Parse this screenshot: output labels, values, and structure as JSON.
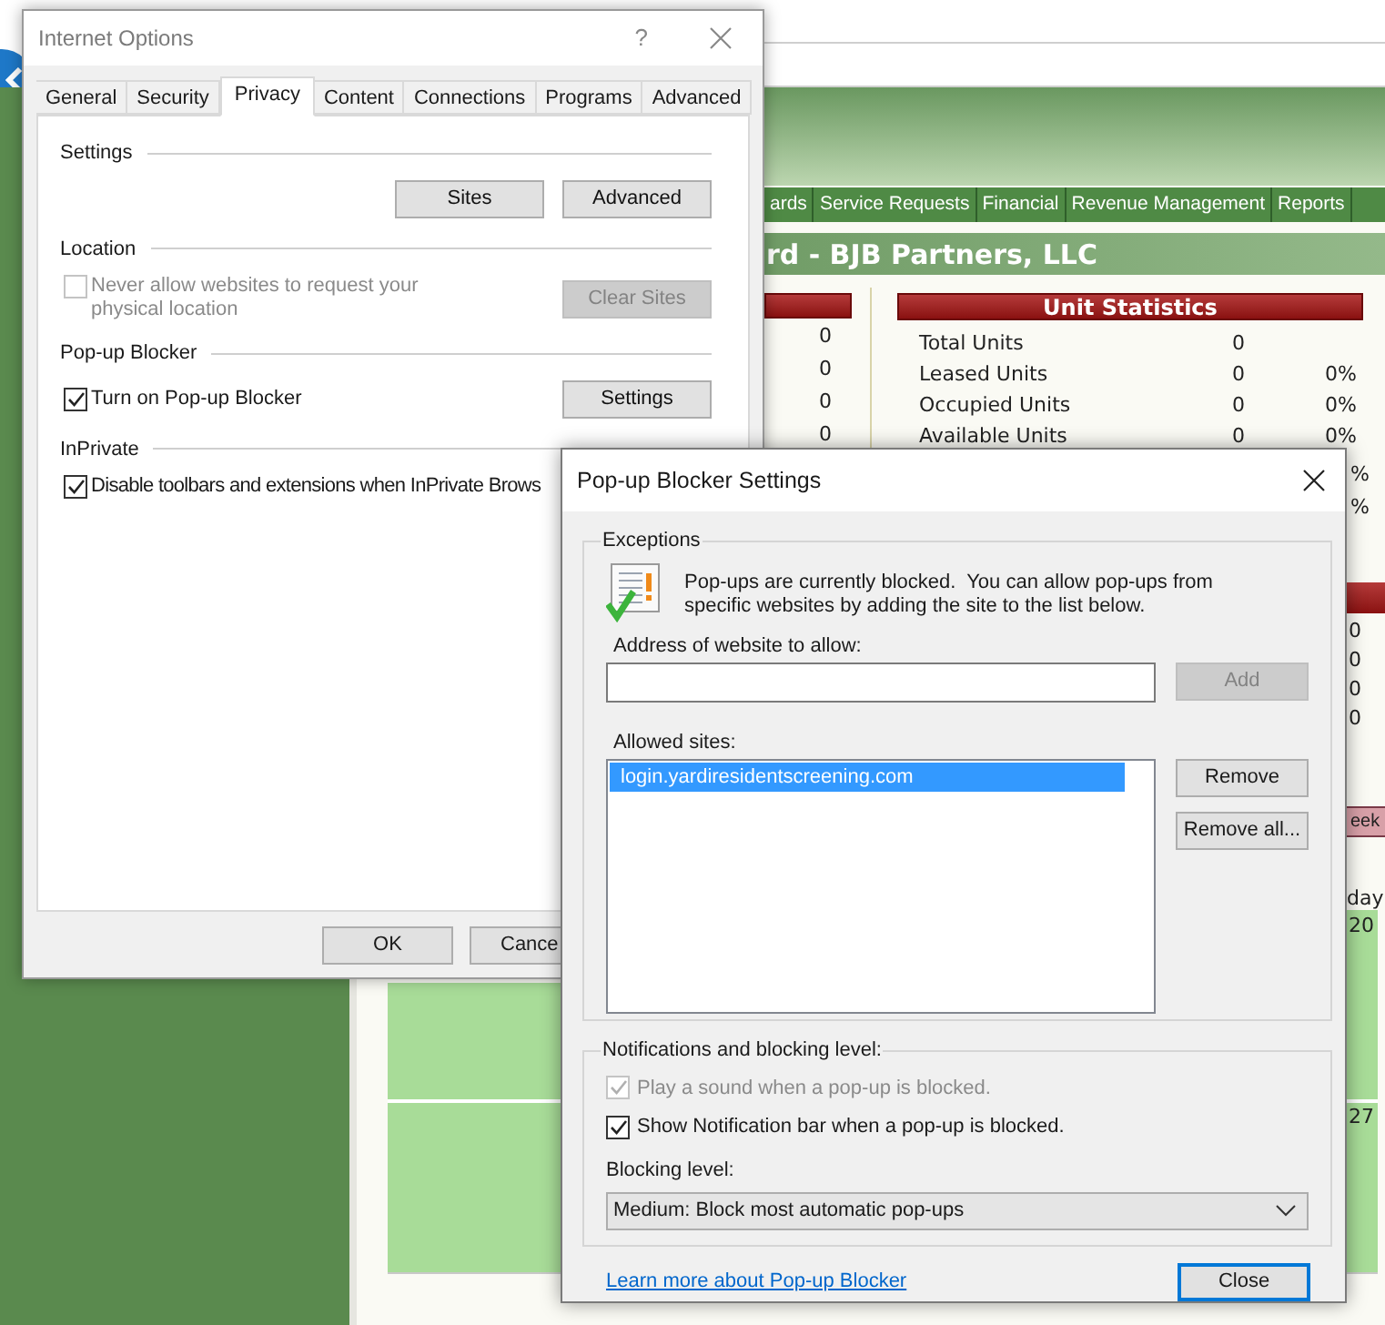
{
  "web_page": {
    "nav_tabs": [
      "ards",
      "Service Requests",
      "Financial",
      "Revenue Management",
      "Reports"
    ],
    "page_title": "rd - BJB Partners, LLC",
    "left_panel": {
      "values": [
        "0",
        "0",
        "0",
        "0"
      ]
    },
    "unit_statistics": {
      "title": "Unit Statistics",
      "rows": [
        {
          "label": "Total Units",
          "count": "0"
        },
        {
          "label": "Leased Units",
          "count": "0",
          "percent": "0%"
        },
        {
          "label": "Occupied Units",
          "count": "0",
          "percent": "0%"
        },
        {
          "label": "Available Units",
          "count": "0",
          "percent": "0%"
        }
      ]
    },
    "right_column": {
      "percents": [
        "%",
        "%"
      ],
      "values": [
        "0",
        "0",
        "0",
        "0"
      ],
      "week_button": "eek",
      "day_header": "day",
      "dates": [
        "20",
        "27"
      ]
    }
  },
  "internet_options": {
    "title": "Internet Options",
    "help": "?",
    "tabs": [
      {
        "label": "General",
        "selected": false
      },
      {
        "label": "Security",
        "selected": false
      },
      {
        "label": "Privacy",
        "selected": true
      },
      {
        "label": "Content",
        "selected": false
      },
      {
        "label": "Connections",
        "selected": false
      },
      {
        "label": "Programs",
        "selected": false
      },
      {
        "label": "Advanced",
        "selected": false
      }
    ],
    "sections": [
      {
        "title": "Settings",
        "buttons": [
          {
            "label": "Sites",
            "disabled": false
          },
          {
            "label": "Advanced",
            "disabled": false
          }
        ]
      },
      {
        "title": "Location",
        "checkbox": {
          "label": "Never allow websites to request your physical location",
          "checked": false,
          "disabled": true
        },
        "buttons": [
          {
            "label": "Clear Sites",
            "disabled": true
          }
        ]
      },
      {
        "title": "Pop-up Blocker",
        "checkbox": {
          "label": "Turn on Pop-up Blocker",
          "checked": true,
          "disabled": false
        },
        "buttons": [
          {
            "label": "Settings",
            "disabled": false
          }
        ]
      },
      {
        "title": "InPrivate",
        "checkbox": {
          "label": "Disable toolbars and extensions when InPrivate Brows",
          "checked": true,
          "disabled": false
        }
      }
    ],
    "buttons": [
      "OK",
      "Cance"
    ]
  },
  "popup_blocker_settings": {
    "title": "Pop-up Blocker Settings",
    "exceptions": {
      "legend": "Exceptions",
      "message": "Pop-ups are currently blocked.  You can allow pop-ups from specific websites by adding the site to the list below.",
      "address_label": "Address of website to allow:",
      "add_button": {
        "label": "Add",
        "disabled": true
      },
      "allowed_sites_label": "Allowed sites:",
      "allowed_sites": [
        {
          "address": "login.yardiresidentscreening.com",
          "selected": true
        }
      ],
      "remove_button": "Remove",
      "remove_all_button": "Remove all..."
    },
    "notifications": {
      "legend": "Notifications and blocking level:",
      "options": [
        {
          "label": "Play a sound when a pop-up is blocked.",
          "checked": true,
          "disabled": true
        },
        {
          "label": "Show Notification bar when a pop-up is blocked.",
          "checked": true,
          "disabled": false
        }
      ],
      "blocking_level_label": "Blocking level:",
      "blocking_level": "Medium: Block most automatic pop-ups"
    },
    "learn_more_link": "Learn more about Pop-up Blocker",
    "close_button": "Close"
  }
}
